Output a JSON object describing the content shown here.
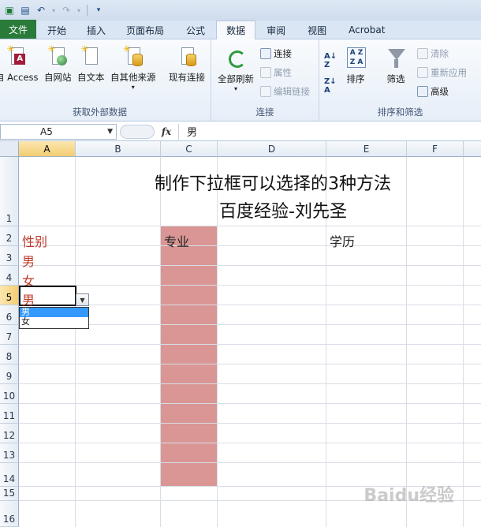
{
  "qat": {
    "icons": [
      "excel-icon",
      "save-icon",
      "undo-icon",
      "redo-icon",
      "customize-icon"
    ]
  },
  "tabs": [
    {
      "label": "文件",
      "kind": "file"
    },
    {
      "label": "开始"
    },
    {
      "label": "插入"
    },
    {
      "label": "页面布局"
    },
    {
      "label": "公式"
    },
    {
      "label": "数据",
      "active": true
    },
    {
      "label": "审阅"
    },
    {
      "label": "视图"
    },
    {
      "label": "Acrobat"
    }
  ],
  "ribbon": {
    "external": {
      "label": "获取外部数据",
      "access": "自 Access",
      "web": "自网站",
      "text": "自文本",
      "other": "自其他来源",
      "other_arrow": "▾",
      "existing": "现有连接"
    },
    "connections": {
      "label": "连接",
      "refresh_all": "全部刷新",
      "refresh_arrow": "▾",
      "connections": "连接",
      "properties": "属性",
      "edit_links": "编辑链接"
    },
    "sort_filter": {
      "label": "排序和筛选",
      "sort": "排序",
      "filter": "筛选",
      "clear": "清除",
      "reapply": "重新应用",
      "advanced": "高级"
    }
  },
  "formula_bar": {
    "name_box": "A5",
    "fx": "fx",
    "value": "男"
  },
  "columns": [
    "A",
    "B",
    "C",
    "D",
    "E",
    "F"
  ],
  "rows": [
    "1",
    "2",
    "3",
    "4",
    "5",
    "6",
    "7",
    "8",
    "9",
    "10",
    "11",
    "12",
    "13",
    "14",
    "15",
    "16"
  ],
  "cells": {
    "title_line1": "制作下拉框可以选择的3种方法",
    "title_line2": "百度经验-刘先圣",
    "a2": "性别",
    "a3": "男",
    "a4": "女",
    "a5": "男",
    "c2": "专业",
    "e2": "学历"
  },
  "dropdown": {
    "items": [
      "男",
      "女"
    ],
    "selected_index": 0
  },
  "watermark": "Baidu经验",
  "colors": {
    "accent_red": "#c0392b",
    "shade": "#d99694",
    "file_tab": "#2a7a3a",
    "selection": "#3399ff"
  }
}
